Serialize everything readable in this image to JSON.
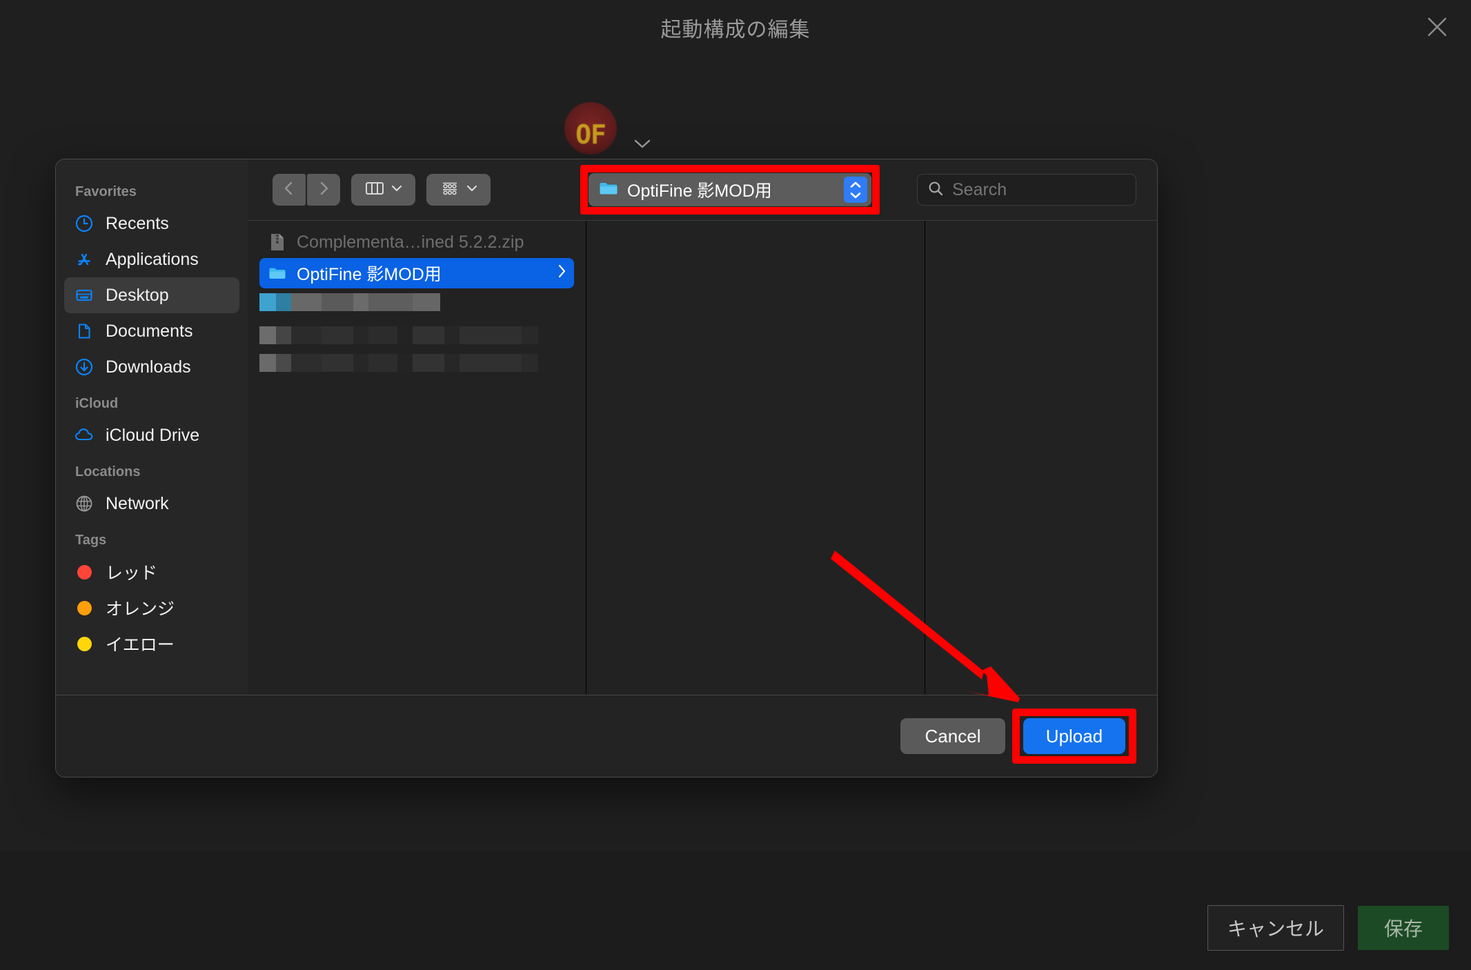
{
  "window": {
    "title": "起動構成の編集",
    "close_icon": "close-icon"
  },
  "background": {
    "profile_badge_text": "OF",
    "profile_chevron_icon": "chevron-down-icon"
  },
  "picker": {
    "sidebar": {
      "groups": [
        {
          "title": "Favorites",
          "items": [
            {
              "label": "Recents",
              "icon": "clock-icon",
              "selected": false
            },
            {
              "label": "Applications",
              "icon": "applications-icon",
              "selected": false
            },
            {
              "label": "Desktop",
              "icon": "desktop-icon",
              "selected": true
            },
            {
              "label": "Documents",
              "icon": "document-icon",
              "selected": false
            },
            {
              "label": "Downloads",
              "icon": "download-icon",
              "selected": false
            }
          ]
        },
        {
          "title": "iCloud",
          "items": [
            {
              "label": "iCloud Drive",
              "icon": "cloud-icon",
              "selected": false
            }
          ]
        },
        {
          "title": "Locations",
          "items": [
            {
              "label": "Network",
              "icon": "globe-icon",
              "selected": false
            }
          ]
        },
        {
          "title": "Tags",
          "items": [
            {
              "label": "レッド",
              "icon": "tag-dot-icon",
              "color": "#ff453a",
              "selected": false
            },
            {
              "label": "オレンジ",
              "icon": "tag-dot-icon",
              "color": "#ff9f0a",
              "selected": false
            },
            {
              "label": "イエロー",
              "icon": "tag-dot-icon",
              "color": "#ffd60a",
              "selected": false
            }
          ]
        }
      ]
    },
    "toolbar": {
      "back_icon": "chevron-left-icon",
      "forward_icon": "chevron-right-icon",
      "view_column_icon": "column-view-icon",
      "view_column_chevron": "chevron-down-icon",
      "group_icon": "group-view-icon",
      "group_chevron": "chevron-down-icon",
      "path_folder_icon": "folder-icon",
      "path_label": "OptiFine 影MOD用",
      "path_stepper_icon": "stepper-updown-icon",
      "search_icon": "search-icon",
      "search_placeholder": "Search",
      "search_value": ""
    },
    "file_list": [
      {
        "name": "Complementa…ined 5.2.2.zip",
        "icon": "zip-file-icon",
        "state": "disabled",
        "has_chevron": false
      },
      {
        "name": "OptiFine 影MOD用",
        "icon": "folder-icon",
        "state": "selected",
        "has_chevron": true,
        "chevron_icon": "chevron-right-icon"
      }
    ],
    "redacted_row_count": 3,
    "footer": {
      "cancel_label": "Cancel",
      "upload_label": "Upload"
    }
  },
  "annotations": {
    "highlight_color": "#ff0000",
    "arrow_color": "#ff0000",
    "highlight_path_popup": true,
    "highlight_upload_button": true,
    "arrow_points_to": "Upload"
  },
  "app_actions": {
    "cancel_label": "キャンセル",
    "save_label": "保存",
    "save_color": "#1c4a25"
  }
}
